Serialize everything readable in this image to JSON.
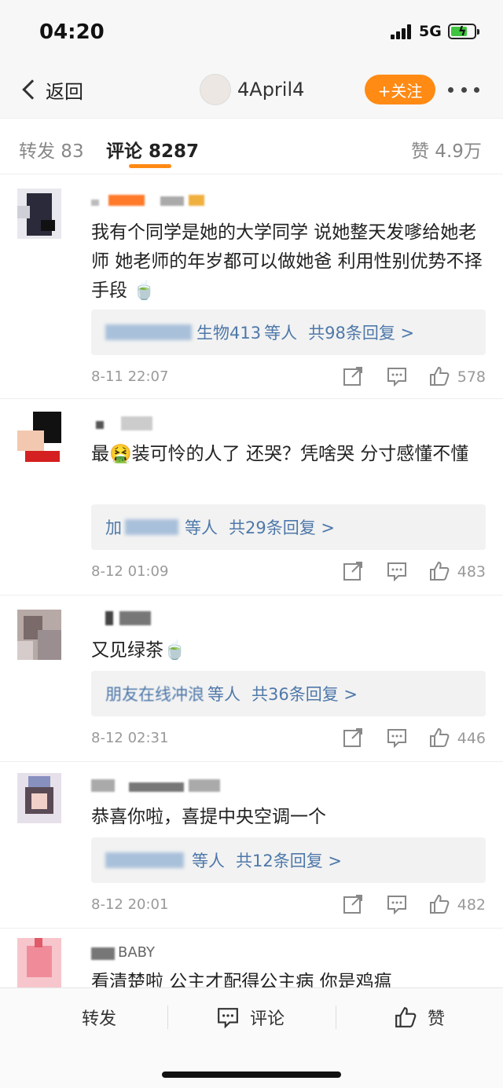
{
  "status_bar": {
    "time": "04:20",
    "network": "5G"
  },
  "nav": {
    "back_label": "返回",
    "title": "4April4",
    "follow_label": "+关注"
  },
  "tabs": [
    {
      "label": "转发 83"
    },
    {
      "label": "评论 8287"
    },
    {
      "label": "赞 4.9万"
    }
  ],
  "comments": [
    {
      "text": "我有个同学是她的大学同学 说她整天发嗲给她老师 她老师的年岁都可以做她爸 利用性别优势不择手段 🍵",
      "reply_who": "生物413",
      "reply_etc": "等人",
      "reply_total": "共98条回复 >",
      "date": "8-11 22:07",
      "likes": "578"
    },
    {
      "text": "最🤮装可怜的人了 还哭？凭啥哭 分寸感懂不懂",
      "reply_who": "加",
      "reply_etc": "等人",
      "reply_total": "共29条回复 >",
      "date": "8-12 01:09",
      "likes": "483"
    },
    {
      "text": "又见绿茶🍵",
      "reply_who": "朋友在线冲浪",
      "reply_etc": "等人",
      "reply_total": "共36条回复 >",
      "date": "8-12 02:31",
      "likes": "446"
    },
    {
      "text": "恭喜你啦，喜提中央空调一个",
      "reply_who": "",
      "reply_etc": "等人",
      "reply_total": "共12条回复 >",
      "date": "8-12 20:01",
      "likes": "482"
    },
    {
      "text": "看清楚啦 公主才配得公主病 你是鸡瘟",
      "name": "BABY"
    }
  ],
  "bottom_bar": {
    "repost": "转发",
    "comment": "评论",
    "like": "赞"
  },
  "colors": {
    "accent": "#ff8a14",
    "link": "#4e78a9"
  }
}
